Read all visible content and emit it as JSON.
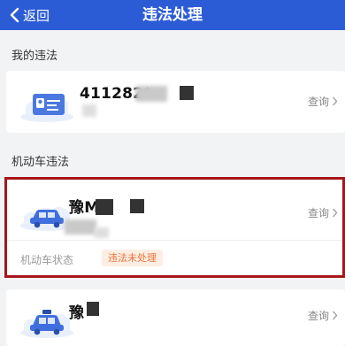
{
  "nav": {
    "back_label": "返回",
    "title": "违法处理"
  },
  "sections": {
    "my_violations": "我的违法",
    "vehicle_violations": "机动车违法"
  },
  "id_card": {
    "number": "411282*"
  },
  "vehicles": [
    {
      "plate": "豫M",
      "status_label": "机动车状态",
      "status_value": "违法未处理"
    },
    {
      "plate": "豫"
    }
  ],
  "query_label": "查询",
  "colors": {
    "nav_bg": "#2c5bd6",
    "highlight_border": "#a7151b",
    "badge_text": "#e8743b",
    "badge_bg": "#fdeee3"
  }
}
